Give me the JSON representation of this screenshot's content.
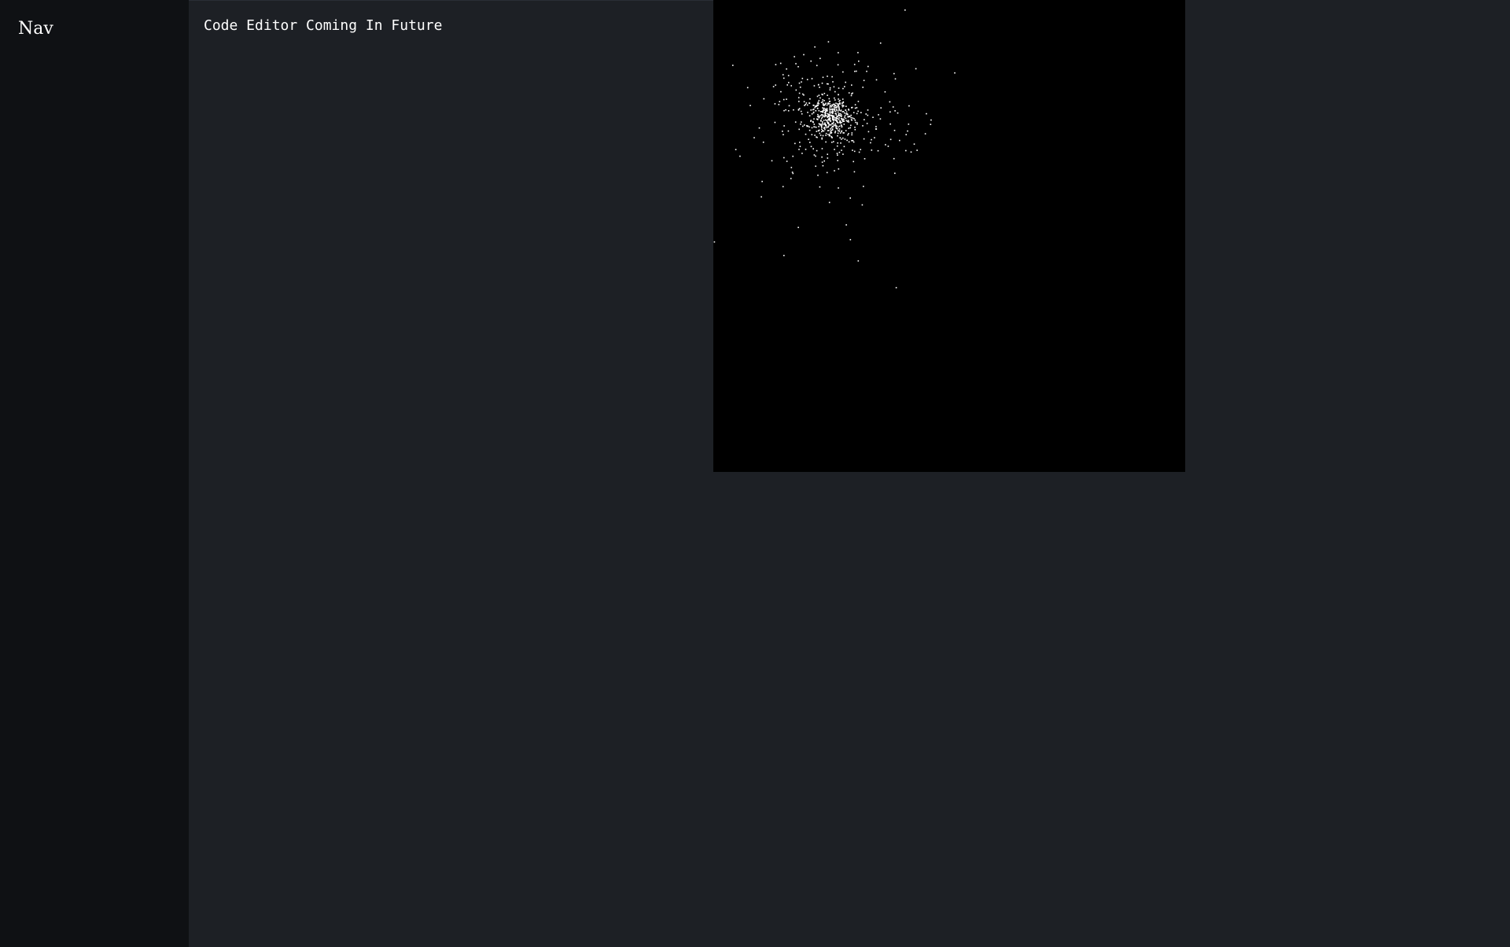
{
  "nav": {
    "title": "Nav"
  },
  "editor": {
    "placeholder_text": "Code Editor Coming In Future"
  },
  "simulation": {
    "background_color": "#000000",
    "particle_color": "#ffffff",
    "particle_count": 700,
    "cluster_center": [
      0.246,
      0.247
    ],
    "cluster_spread": [
      0.07,
      0.06
    ],
    "seed": 42
  },
  "colors": {
    "nav_bg": "#0f1114",
    "panel_bg": "#1d2025",
    "text": "#ffffff"
  }
}
